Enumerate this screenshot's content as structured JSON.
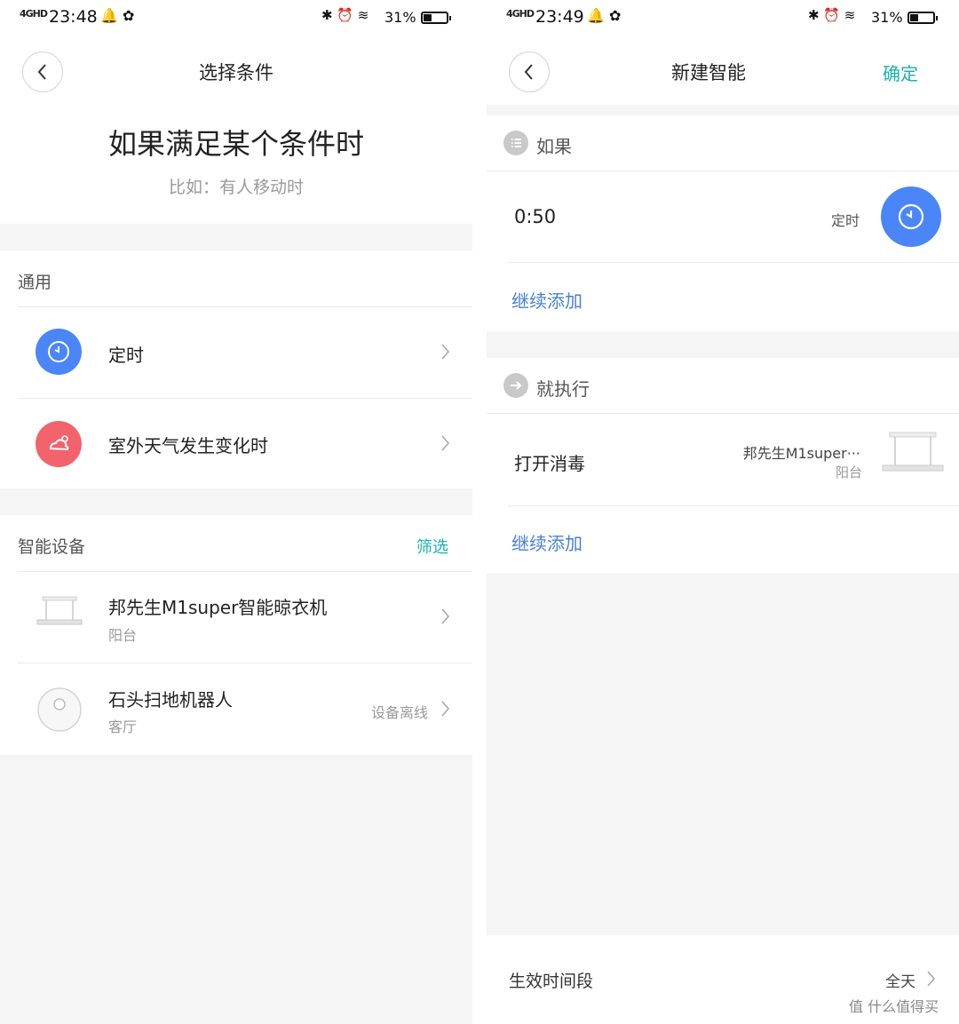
{
  "left": {
    "status": {
      "network": "4GHD",
      "time": "23:48",
      "battery": "31%"
    },
    "title": "选择条件",
    "heading": "如果满足某个条件时",
    "subheading": "比如：有人移动时",
    "sections": {
      "general": {
        "label": "通用",
        "items": [
          {
            "label": "定时",
            "icon": "clock-icon",
            "color": "#4a86f7"
          },
          {
            "label": "室外天气发生变化时",
            "icon": "weather-icon",
            "color": "#f2636b"
          }
        ]
      },
      "devices": {
        "label": "智能设备",
        "filter": "筛选",
        "items": [
          {
            "name": "邦先生M1super智能晾衣机",
            "room": "阳台",
            "status": ""
          },
          {
            "name": "石头扫地机器人",
            "room": "客厅",
            "status": "设备离线"
          }
        ]
      }
    }
  },
  "right": {
    "status": {
      "network": "4GHD",
      "time": "23:49",
      "battery": "31%"
    },
    "title": "新建智能",
    "confirm": "确定",
    "if_section": {
      "label": "如果",
      "condition": {
        "value": "0:50",
        "type": "定时"
      },
      "add_more": "继续添加"
    },
    "then_section": {
      "label": "就执行",
      "action": {
        "label": "打开消毒",
        "device": "邦先生M1super···",
        "room": "阳台"
      },
      "add_more": "继续添加"
    },
    "effective": {
      "label": "生效时间段",
      "value": "全天"
    }
  },
  "watermark": "值 什么值得买",
  "colors": {
    "accent": "#1bb2b2",
    "link": "#4a7fd6",
    "clock": "#4a86f7",
    "weather": "#f2636b"
  }
}
